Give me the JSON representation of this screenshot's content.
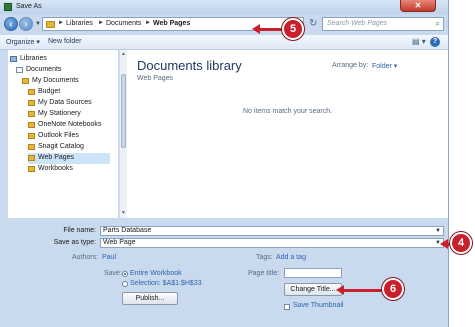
{
  "window": {
    "title": "Save As"
  },
  "nav": {
    "breadcrumbs": [
      "Libraries",
      "Documents",
      "Web Pages"
    ],
    "search_placeholder": "Search Web Pages"
  },
  "toolbar": {
    "organize": "Organize ▾",
    "new_folder": "New folder"
  },
  "sidebar": {
    "items": [
      {
        "label": "Libraries",
        "icon": "library-icon"
      },
      {
        "label": "Documents",
        "icon": "document-icon"
      },
      {
        "label": "My Documents",
        "icon": "folder-icon"
      },
      {
        "label": "Budget",
        "icon": "folder-icon"
      },
      {
        "label": "My Data Sources",
        "icon": "folder-icon"
      },
      {
        "label": "My Stationery",
        "icon": "folder-icon"
      },
      {
        "label": "OneNote Notebooks",
        "icon": "folder-icon"
      },
      {
        "label": "Outlook Files",
        "icon": "folder-icon"
      },
      {
        "label": "Snagit Catalog",
        "icon": "folder-icon"
      },
      {
        "label": "Web Pages",
        "icon": "folder-icon",
        "selected": true
      },
      {
        "label": "Workbooks",
        "icon": "folder-icon"
      }
    ]
  },
  "main": {
    "library_title": "Documents library",
    "library_subtitle": "Web Pages",
    "arrange_label": "Arrange by:",
    "arrange_value": "Folder ▾",
    "empty_message": "No items match your search."
  },
  "form": {
    "file_name_label": "File name:",
    "file_name_value": "Parts Database",
    "save_as_type_label": "Save as type:",
    "save_as_type_value": "Web Page",
    "authors_label": "Authors:",
    "authors_value": "Paul",
    "tags_label": "Tags:",
    "tags_value": "Add a tag",
    "save_label": "Save:",
    "entire_workbook": "Entire Workbook",
    "selection": "Selection: $A$1:$H$33",
    "page_title_label": "Page title:",
    "publish_button": "Publish...",
    "change_title_button": "Change Title...",
    "save_thumbnail": "Save Thumbnail"
  },
  "callouts": {
    "five": "5",
    "four": "4",
    "six": "6"
  },
  "colors": {
    "callout": "#c8202c",
    "window_chrome": "#c9daee"
  }
}
